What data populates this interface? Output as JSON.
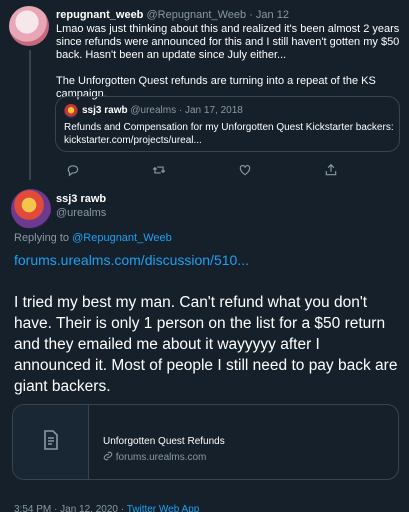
{
  "parent_tweet": {
    "display_name": "repugnant_weeb",
    "handle": "@Repugnant_Weeb",
    "separator": "·",
    "date": "Jan 12",
    "paragraph1": "Lmao was just thinking about this and realized it's been almost 2 years since refunds were announced for this and I still haven't gotten my $50 back. Hasn't been an update since July either...",
    "paragraph2": "The Unforgotten Quest refunds are turning into a repeat of the KS campaign.",
    "quoted": {
      "display_name": "ssj3 rawb",
      "handle": "@urealms",
      "separator": "·",
      "date": "Jan 17, 2018",
      "text": "Refunds and Compensation for my Unforgotten Quest Kickstarter backers: kickstarter.com/projects/ureal..."
    }
  },
  "main_tweet": {
    "display_name": "ssj3 rawb",
    "handle": "@urealms",
    "replying_prefix": "Replying to",
    "replying_to": "@Repugnant_Weeb",
    "link": "forums.urealms.com/discussion/510...",
    "text": "I tried my best my man. Can't refund what you don't have. Their is only 1 person on the list for a $50 return and they emailed me about it wayyyyy after I announced it. Most of people I still need to pay back are giant backers.",
    "card": {
      "title": "Unforgotten Quest Refunds",
      "domain": "forums.urealms.com"
    },
    "timestamp": "3:54 PM · Jan 12, 2020 ·",
    "source": "Twitter Web App"
  },
  "icons": [
    "reply-icon",
    "retweet-icon",
    "like-icon",
    "share-icon",
    "document-icon",
    "link-icon"
  ],
  "colors": {
    "background": "#15202b",
    "accent": "#1da1f2",
    "muted": "#8899a6",
    "border": "#38444d"
  }
}
